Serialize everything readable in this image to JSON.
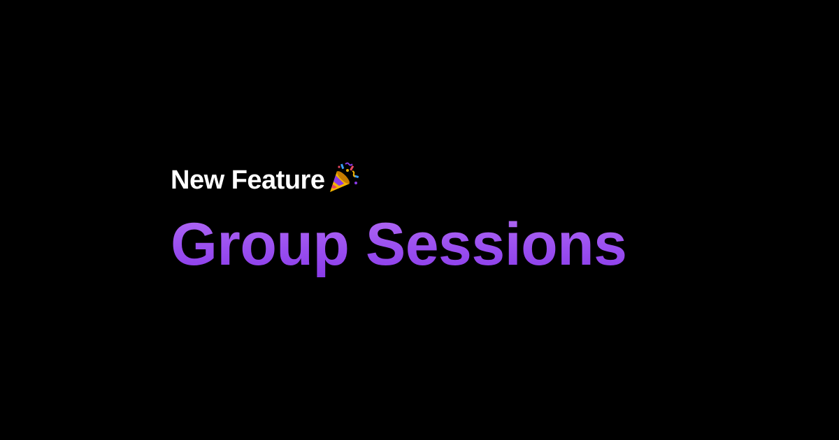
{
  "announcement": {
    "eyebrow": "New Feature",
    "eyebrow_icon": "party-popper-icon",
    "headline": "Group Sessions"
  },
  "colors": {
    "background": "#000000",
    "eyebrow_text": "#ffffff",
    "headline_top": "#b46cf3",
    "headline_bottom": "#8a3be8"
  }
}
